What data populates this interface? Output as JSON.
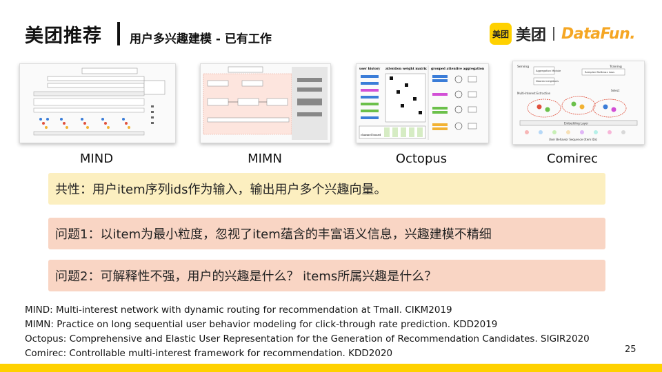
{
  "header": {
    "title": "美团推荐",
    "subtitle": "用户多兴趣建模 - 已有工作"
  },
  "logo": {
    "badge": "美团",
    "brand": "美团",
    "partner": "DataFun.",
    "accent_color": "#FFD100",
    "partner_color": "#F5A623"
  },
  "figures": [
    {
      "caption": "MIND"
    },
    {
      "caption": "MIMN"
    },
    {
      "caption": "Octopus"
    },
    {
      "caption": "Comirec"
    }
  ],
  "figure_text": {
    "octopus_history": "user history",
    "octopus_attention": "attention weight matrix",
    "octopus_grouped": "grouped attentive aggregation",
    "octopus_board": "channel board",
    "comirec_serving": "Serving",
    "comirec_training": "Training",
    "comirec_module": "Aggregation Module",
    "comirec_nearest": "Nearest neighbors",
    "comirec_loss": "Sampled Softmax Loss",
    "comirec_multi": "Multi-Interest Extraction",
    "comirec_select": "Select",
    "comirec_embedding": "Embedding Layer",
    "comirec_sequence": "User Behavior Sequence (Item IDs)"
  },
  "points": {
    "common": "共性：用户item序列ids作为输入，输出用户多个兴趣向量。",
    "problem1": "问题1：以item为最小粒度，忽视了item蕴含的丰富语义信息，兴趣建模不精细",
    "problem2": "问题2：可解释性不强，用户的兴趣是什么？ items所属兴趣是什么？"
  },
  "references": [
    "MIND: Multi-interest network with dynamic routing for recommendation at Tmall. CIKM2019",
    "MIMN: Practice on long sequential user behavior modeling for click-through rate prediction. KDD2019",
    "Octopus: Comprehensive and Elastic User Representation for the Generation of Recommendation Candidates. SIGIR2020",
    "Comirec: Controllable multi-interest framework for recommendation. KDD2020"
  ],
  "page_number": "25"
}
